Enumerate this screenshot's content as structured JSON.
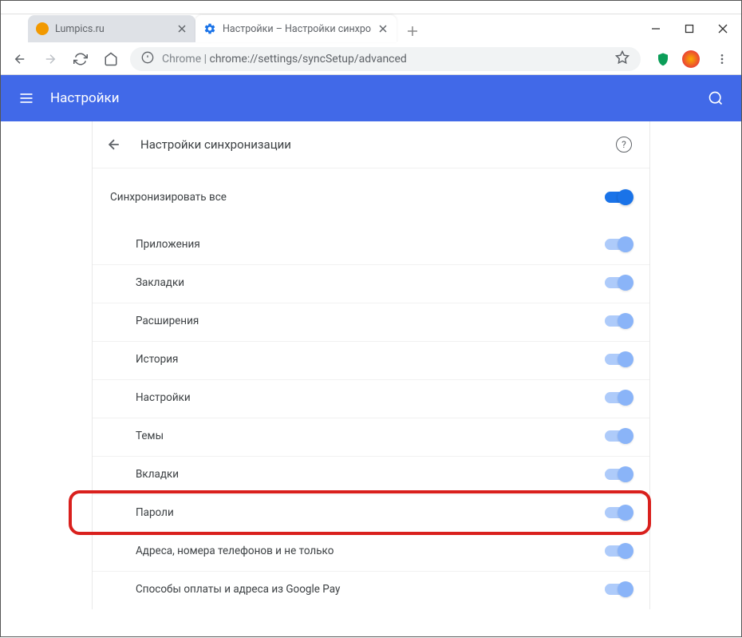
{
  "tabs": [
    {
      "title": "Lumpics.ru",
      "active": false
    },
    {
      "title": "Настройки – Настройки синхро",
      "active": true
    }
  ],
  "omnibox": {
    "scheme_label": "Chrome",
    "url": "chrome://settings/syncSetup/advanced"
  },
  "settings_header": {
    "title": "Настройки"
  },
  "sync_page": {
    "header": "Настройки синхронизации",
    "sync_all": "Синхронизировать все",
    "items": [
      {
        "label": "Приложения"
      },
      {
        "label": "Закладки"
      },
      {
        "label": "Расширения"
      },
      {
        "label": "История"
      },
      {
        "label": "Настройки"
      },
      {
        "label": "Темы"
      },
      {
        "label": "Вкладки"
      },
      {
        "label": "Пароли"
      },
      {
        "label": "Адреса, номера телефонов и не только"
      },
      {
        "label": "Способы оплаты и адреса из Google Pay"
      }
    ]
  }
}
